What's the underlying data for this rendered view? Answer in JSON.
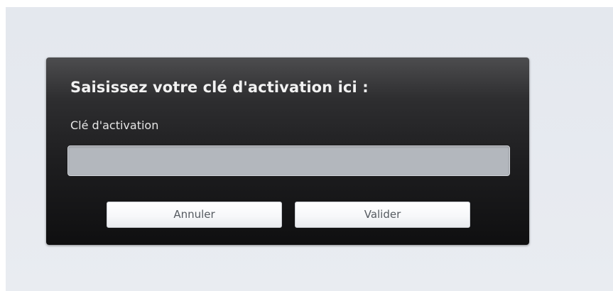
{
  "dialog": {
    "title": "Saisissez votre clé d'activation ici :",
    "field_label": "Clé d'activation",
    "input": {
      "value": "",
      "placeholder": ""
    },
    "buttons": {
      "cancel_label": "Annuler",
      "submit_label": "Valider"
    }
  }
}
